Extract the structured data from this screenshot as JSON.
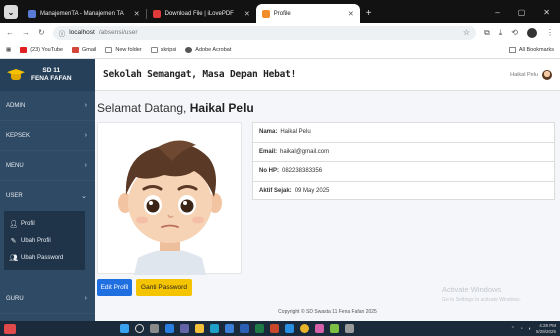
{
  "browser": {
    "tabs": [
      {
        "title": "ManajemenTA - Manajemen TA",
        "color": "#5b7cd6",
        "active": false
      },
      {
        "title": "Download File | iLovePDF",
        "color": "#e03a3a",
        "active": false
      },
      {
        "title": "Profile",
        "color": "#f08c2a",
        "active": true
      }
    ],
    "new_tab_glyph": "+",
    "url_host": "localhost",
    "url_path": "/absensi/user",
    "bookmarks": [
      {
        "label": "(23) YouTube",
        "color": "#e02020"
      },
      {
        "label": "Gmail",
        "color": "#d44638"
      },
      {
        "label": "New folder",
        "color": "#888888"
      },
      {
        "label": "skripsi",
        "color": "#888888"
      },
      {
        "label": "Adobe Acrobat",
        "color": "#555555"
      }
    ],
    "all_bookmarks": "All Bookmarks"
  },
  "sidebar": {
    "brand_line1": "SD 11",
    "brand_line2": "FENA FAFAN",
    "menu": [
      {
        "label": "ADMIN"
      },
      {
        "label": "KEPSEK"
      },
      {
        "label": "MENU"
      },
      {
        "label": "USER"
      }
    ],
    "submenu": [
      {
        "label": "Profil",
        "icon": "person-icon"
      },
      {
        "label": "Ubah Profil",
        "icon": "user-edit-icon"
      },
      {
        "label": "Ubah Password",
        "icon": "users-icon"
      }
    ],
    "menu_after": [
      {
        "label": "GURU"
      }
    ]
  },
  "topbar": {
    "title": "Sekolah Semangat, Masa Depan Hebat!",
    "user_name": "Haikal Pelu"
  },
  "main": {
    "welcome_prefix": "Selamat Datang,",
    "welcome_name": "Haikal Pelu",
    "info": [
      {
        "label": "Nama:",
        "value": "Haikal Pelu"
      },
      {
        "label": "Email:",
        "value": "haikal@gmail.com"
      },
      {
        "label": "No HP:",
        "value": "082238383356"
      },
      {
        "label": "Aktif Sejak:",
        "value": "09 May 2025"
      }
    ],
    "edit_button": "Edit Profil",
    "password_button": "Ganti Password",
    "footer": "Copyright © SD Swasta 11 Fena Fafan 2025",
    "watermark_title": "Activate Windows",
    "watermark_sub": "Go to Settings to activate Windows."
  },
  "taskbar": {
    "time": "4:28 PM",
    "date": "5/29/2025"
  }
}
